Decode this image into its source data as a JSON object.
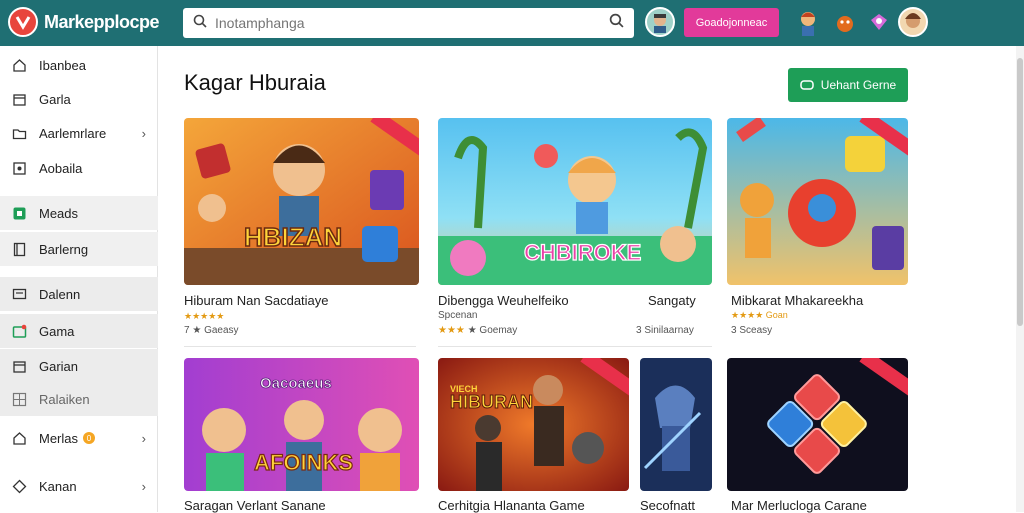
{
  "app": {
    "brand": "Markepplocpe"
  },
  "search": {
    "placeholder": "Inotamphanga"
  },
  "header": {
    "cta_label": "Goadojonneac"
  },
  "sidebar": {
    "items": [
      {
        "label": "Ibanbea",
        "icon": "home-icon"
      },
      {
        "label": "Garla",
        "icon": "calendar-icon"
      },
      {
        "label": "Aarlemrlare",
        "icon": "folder-icon",
        "chevron": "›"
      },
      {
        "label": "Aobaila",
        "icon": "tag-icon"
      },
      {
        "label": "Meads",
        "icon": "game-icon"
      },
      {
        "label": "Barlerng",
        "icon": "book-icon"
      },
      {
        "label": "Dalenn",
        "icon": "message-icon"
      },
      {
        "label": "Gama",
        "icon": "gamepad-icon"
      },
      {
        "label": "Garian",
        "icon": "calendar-icon"
      },
      {
        "label": "Ralaiken",
        "icon": "grid-icon"
      },
      {
        "label": "Merlas",
        "icon": "home-icon",
        "chevron": "›",
        "badge": "0"
      },
      {
        "label": "Kanan",
        "icon": "cube-icon",
        "chevron": "›"
      }
    ]
  },
  "main": {
    "title": "Kagar Hburaia",
    "action_label": "Uehant Gerne",
    "cards": [
      {
        "title": "Hiburam Nan Sacdatiaye",
        "stars": "★★★★★",
        "meta": "7 ★ Gaeasy",
        "art_text": "HBIZAN"
      },
      {
        "title": "Dibengga Weuhelfeiko",
        "title_right": "Sangaty",
        "sub": "Spcenan",
        "stars": "★★★",
        "meta": "★ Goemay",
        "meta_right": "3 Sinilaarnay",
        "art_text": "CHBIROKE"
      },
      {
        "title": "Mibkarat Mhakareekha",
        "stars": "★★★★ Goan",
        "meta": "3 Sceasy"
      },
      {
        "title": "Saragan Verlant Sanane",
        "art_text": "AFOINKS",
        "art_top": "Oacoaeus"
      },
      {
        "title": "Cerhitgia Hlananta Game",
        "art_text": "HIBURAN",
        "art_top": "VIECH"
      },
      {
        "title": "Secofnatt"
      },
      {
        "title": "Mar Merlucloga Carane"
      }
    ]
  },
  "colors": {
    "topbar": "#1f6f73",
    "accent_pink": "#e23a9a",
    "accent_green": "#1e9e57",
    "star": "#e39a13"
  }
}
